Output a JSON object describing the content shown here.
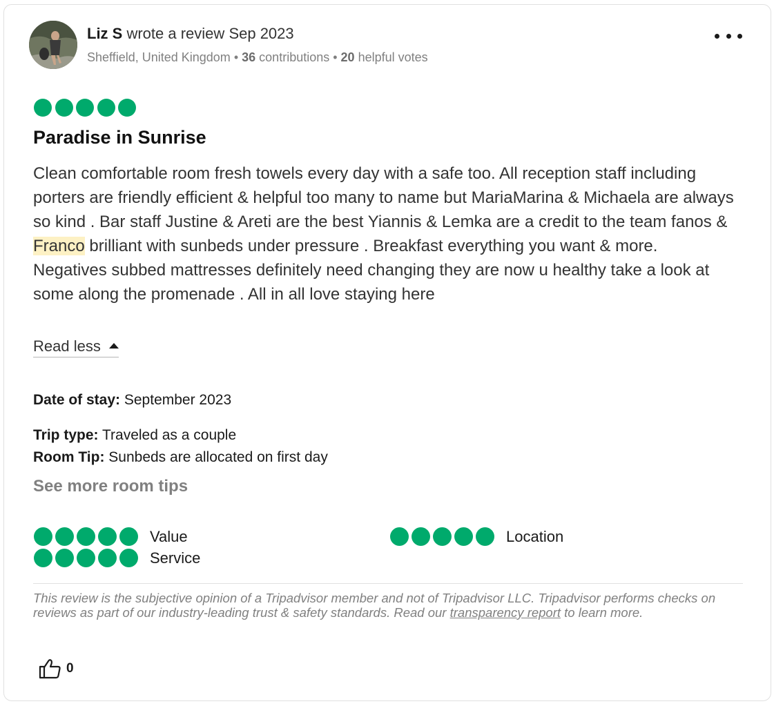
{
  "review": {
    "author": "Liz S",
    "action": "wrote a review",
    "date": "Sep 2023",
    "location": "Sheffield, United Kingdom",
    "contributions_count": "36",
    "contributions_label": "contributions",
    "helpful_votes_count": "20",
    "helpful_votes_label": "helpful votes",
    "rating": 5,
    "title": "Paradise in Sunrise",
    "body_line1_a": "Clean comfortable room fresh towels every day with a safe too. All reception staff including porters are friendly efficient & helpful too many to name but MariaMarina & Michaela are always so kind . Bar staff Justine & Areti are the best Yiannis & Lemka are a credit to the team fanos & ",
    "body_highlight": "Franco",
    "body_line1_b": " brilliant with sunbeds under pressure . Breakfast everything you want & more.",
    "body_line2": "Negatives subbed mattresses definitely need changing they are now u healthy take a look at some along the promenade . All in all love staying here",
    "read_less": "Read less",
    "date_of_stay_label": "Date of stay:",
    "date_of_stay_value": "September 2023",
    "trip_type_label": "Trip type:",
    "trip_type_value": "Traveled as a couple",
    "room_tip_label": "Room Tip:",
    "room_tip_value": "Sunbeds are allocated on first day",
    "see_more_room_tips": "See more room tips",
    "sub_ratings": [
      {
        "label": "Value",
        "rating": 5
      },
      {
        "label": "Service",
        "rating": 5
      },
      {
        "label": "Location",
        "rating": 5
      }
    ],
    "disclaimer_text": "This review is the subjective opinion of a Tripadvisor member and not of Tripadvisor LLC. Tripadvisor performs checks on reviews as part of our industry-leading trust & safety standards. Read our ",
    "disclaimer_link": "transparency report",
    "disclaimer_end": " to learn more.",
    "helpful_count": "0"
  },
  "colors": {
    "bubble": "#00aa6c",
    "highlight": "#fdf1c4",
    "muted_text": "#808080"
  },
  "icons": {
    "menu": "ellipsis-icon",
    "helpful": "thumbs-up-icon",
    "caret": "caret-up-icon"
  }
}
